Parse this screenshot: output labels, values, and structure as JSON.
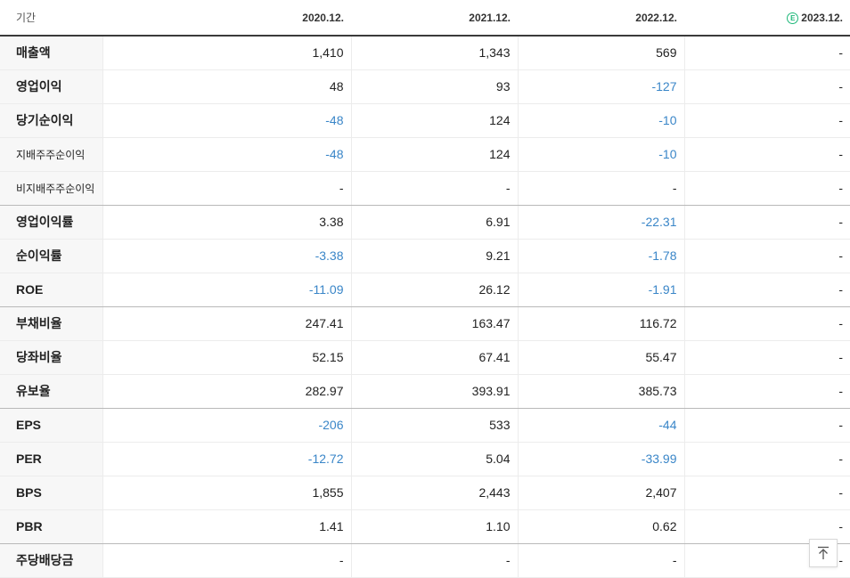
{
  "header": {
    "period_label": "기간",
    "years": [
      "2020.12.",
      "2021.12.",
      "2022.12.",
      "2023.12."
    ],
    "estimate_badge": "E"
  },
  "rows": [
    {
      "label": "매출액",
      "small": false,
      "values": [
        "1,410",
        "1,343",
        "569",
        "-"
      ]
    },
    {
      "label": "영업이익",
      "small": false,
      "values": [
        "48",
        "93",
        "-127",
        "-"
      ]
    },
    {
      "label": "당기순이익",
      "small": false,
      "values": [
        "-48",
        "124",
        "-10",
        "-"
      ]
    },
    {
      "label": "지배주주순이익",
      "small": true,
      "values": [
        "-48",
        "124",
        "-10",
        "-"
      ]
    },
    {
      "label": "비지배주주순이익",
      "small": true,
      "values": [
        "-",
        "-",
        "-",
        "-"
      ],
      "group_end": true
    },
    {
      "label": "영업이익률",
      "small": false,
      "values": [
        "3.38",
        "6.91",
        "-22.31",
        "-"
      ]
    },
    {
      "label": "순이익률",
      "small": false,
      "values": [
        "-3.38",
        "9.21",
        "-1.78",
        "-"
      ]
    },
    {
      "label": "ROE",
      "small": false,
      "values": [
        "-11.09",
        "26.12",
        "-1.91",
        "-"
      ],
      "group_end": true
    },
    {
      "label": "부채비율",
      "small": false,
      "values": [
        "247.41",
        "163.47",
        "116.72",
        "-"
      ]
    },
    {
      "label": "당좌비율",
      "small": false,
      "values": [
        "52.15",
        "67.41",
        "55.47",
        "-"
      ]
    },
    {
      "label": "유보율",
      "small": false,
      "values": [
        "282.97",
        "393.91",
        "385.73",
        "-"
      ],
      "group_end": true
    },
    {
      "label": "EPS",
      "small": false,
      "values": [
        "-206",
        "533",
        "-44",
        "-"
      ]
    },
    {
      "label": "PER",
      "small": false,
      "values": [
        "-12.72",
        "5.04",
        "-33.99",
        "-"
      ]
    },
    {
      "label": "BPS",
      "small": false,
      "values": [
        "1,855",
        "2,443",
        "2,407",
        "-"
      ]
    },
    {
      "label": "PBR",
      "small": false,
      "values": [
        "1.41",
        "1.10",
        "0.62",
        "-"
      ],
      "group_end": true
    },
    {
      "label": "주당배당금",
      "small": false,
      "values": [
        "-",
        "-",
        "-",
        "-"
      ]
    }
  ],
  "colors": {
    "negative": "#3a86c8",
    "estimate": "#1fb87a"
  },
  "scroll_top_icon": "arrow-up-to-top-icon"
}
